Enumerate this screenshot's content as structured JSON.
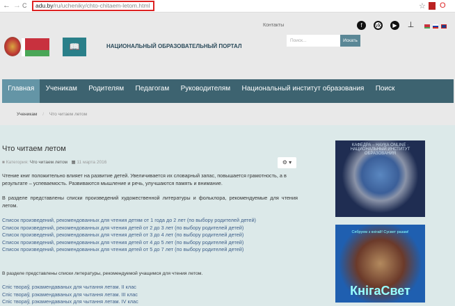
{
  "browser": {
    "back": "←",
    "forward": "→",
    "reload": "C",
    "url_host": "adu.by",
    "url_path": "/ru/ucheniky/chto-chitaem-letom.html",
    "star": "☆"
  },
  "topbar": {
    "contacts": "Контакты",
    "social": [
      "facebook-icon",
      "vk-icon",
      "youtube-icon",
      "sitemap-icon"
    ],
    "languages": [
      "be",
      "ru",
      "en"
    ]
  },
  "header": {
    "portal_title": "НАЦИОНАЛЬНЫЙ ОБРАЗОВАТЕЛЬНЫЙ ПОРТАЛ",
    "search_placeholder": "Поиск...",
    "search_button": "Искать"
  },
  "nav": {
    "items": [
      "Главная",
      "Ученикам",
      "Родителям",
      "Педагогам",
      "Руководителям",
      "Национальный институт образования",
      "Поиск"
    ],
    "active": 0
  },
  "breadcrumb": {
    "items": [
      "Ученикам",
      "Что читаем летом"
    ],
    "separator": "/"
  },
  "article": {
    "title": "Что читаем летом",
    "category_label": "Категория:",
    "category": "Что читаем летом",
    "date": "11 марта 2016",
    "gear": "⚙ ▾",
    "intro": "Чтение книг положительно влияет на развитие детей. Увеличивается их словарный запас, повышается грамотность, а в результате – успеваемость. Развиваются мышление и речь, улучшаются память и внимание.",
    "section1": "В разделе представлены списки произведений художественной литературы и фольклора, рекомендуемые для чтения летом.",
    "links1": [
      "Список произведений, рекомендованных для чтения детям от 1 года до 2 лет (по выбору родителей детей)",
      "Список произведений, рекомендованных для чтения детей от 2 до 3 лет (по выбору родителей детей)",
      "Список произведений, рекомендованных для чтения детей от 3 до 4 лет (по выбору родителей детей)",
      "Список произведений, рекомендованных для чтения детей от 4 до 5 лет (по выбору родителей детей)",
      "Список произведений, рекомендованных для чтения детей от 5 до 7 лет (по выбору родителей детей)"
    ],
    "section2": "В разделе представлены списки литературы, рекомендуемой учащимся для чтения летом.",
    "links2": [
      "Спіс твораў, рэкамендаваных для чытання летам. II клас",
      "Спіс твораў, рэкамендаваных для чытання летам. III клас",
      "Спіс твораў, рэкамендаваных для чытання летам. IV клас"
    ]
  },
  "sidebar": {
    "banner1": "КАФЕДРА – НАУКА ONLINE · НАЦИОНАЛЬНЫЙ ИНСТИТУТ ОБРАЗОВАНИЯ",
    "banner2_top": "Сябруем з кнігай! Сусвет разам!",
    "banner2": "КнігаСвет"
  }
}
